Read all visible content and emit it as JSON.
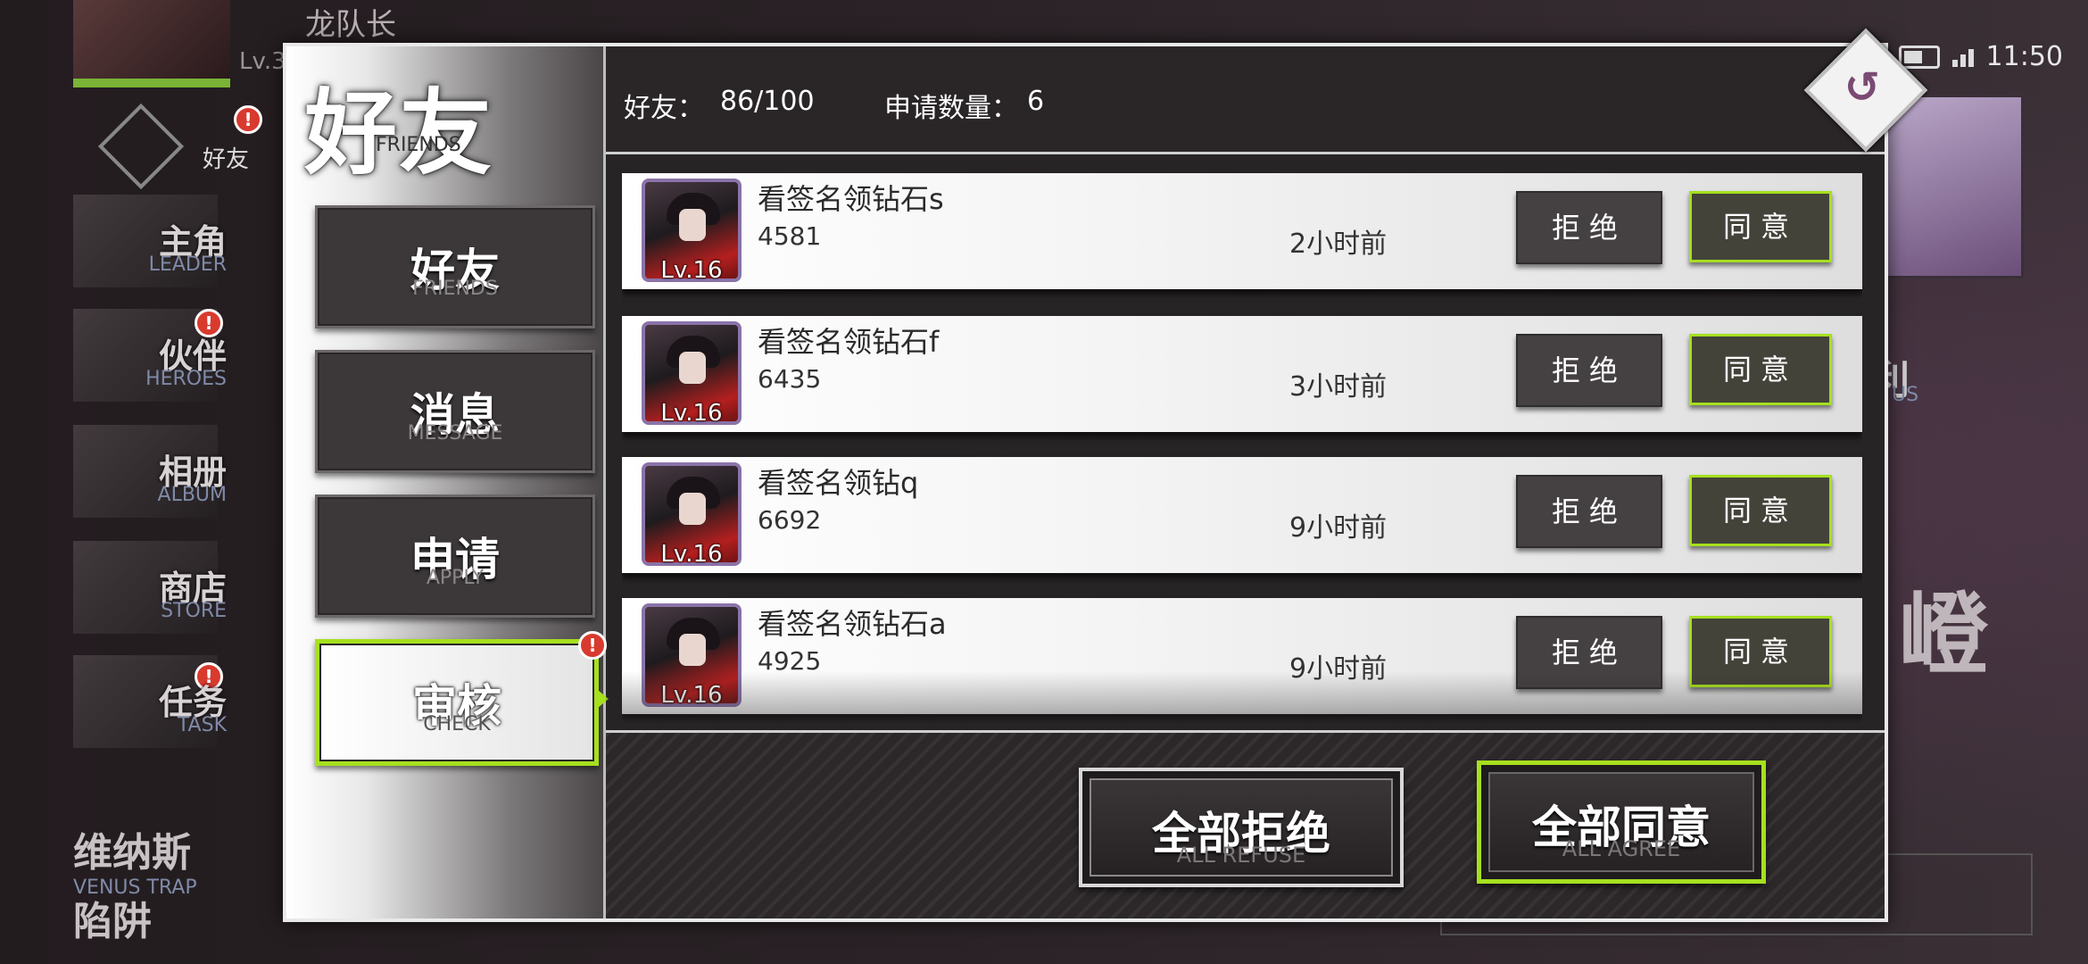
{
  "background": {
    "captain_name": "龙队长",
    "level_prefix": "Lv.3",
    "friends_tab_label": "好友",
    "menu": [
      {
        "zh": "主角",
        "en": "LEADER"
      },
      {
        "zh": "伙伴",
        "en": "HEROES"
      },
      {
        "zh": "相册",
        "en": "ALBUM"
      },
      {
        "zh": "商店",
        "en": "STORE"
      },
      {
        "zh": "任务",
        "en": "TASK"
      }
    ],
    "event": {
      "zh": "维纳斯",
      "en": "VENUS TRAP",
      "zh2": "陷阱"
    },
    "right_label_zh": "利",
    "right_label_en": "US",
    "right_big_zh": "嶝"
  },
  "status_bar": {
    "time": "11:50"
  },
  "dialog": {
    "title_zh": "好友",
    "title_en": "FRIENDS",
    "tabs": [
      {
        "zh": "好友",
        "en": "FRIENDS"
      },
      {
        "zh": "消息",
        "en": "MESSAGE"
      },
      {
        "zh": "申请",
        "en": "APPLY"
      },
      {
        "zh": "审核",
        "en": "CHECK"
      }
    ],
    "active_tab": "审核",
    "alert_mark": "!",
    "header": {
      "friends_label": "好友：",
      "friends_count": "86/100",
      "apply_label": "申请数量：",
      "apply_count": "6"
    },
    "back_icon": "↺",
    "requests": [
      {
        "name": "看签名领钻石s",
        "id": "4581",
        "time": "2小时前",
        "level": "Lv.16"
      },
      {
        "name": "看签名领钻石f",
        "id": "6435",
        "time": "3小时前",
        "level": "Lv.16"
      },
      {
        "name": "看签名领钻q",
        "id": "6692",
        "time": "9小时前",
        "level": "Lv.16"
      },
      {
        "name": "看签名领钻石a",
        "id": "4925",
        "time": "9小时前",
        "level": "Lv.16"
      }
    ],
    "refuse_label": "拒绝",
    "agree_label": "同意",
    "refuse_all": {
      "zh": "全部拒绝",
      "en": "ALL REFUSE"
    },
    "agree_all": {
      "zh": "全部同意",
      "en": "ALL AGREE"
    }
  },
  "colors": {
    "accent": "#a6e01e",
    "alert": "#d83a2e"
  }
}
